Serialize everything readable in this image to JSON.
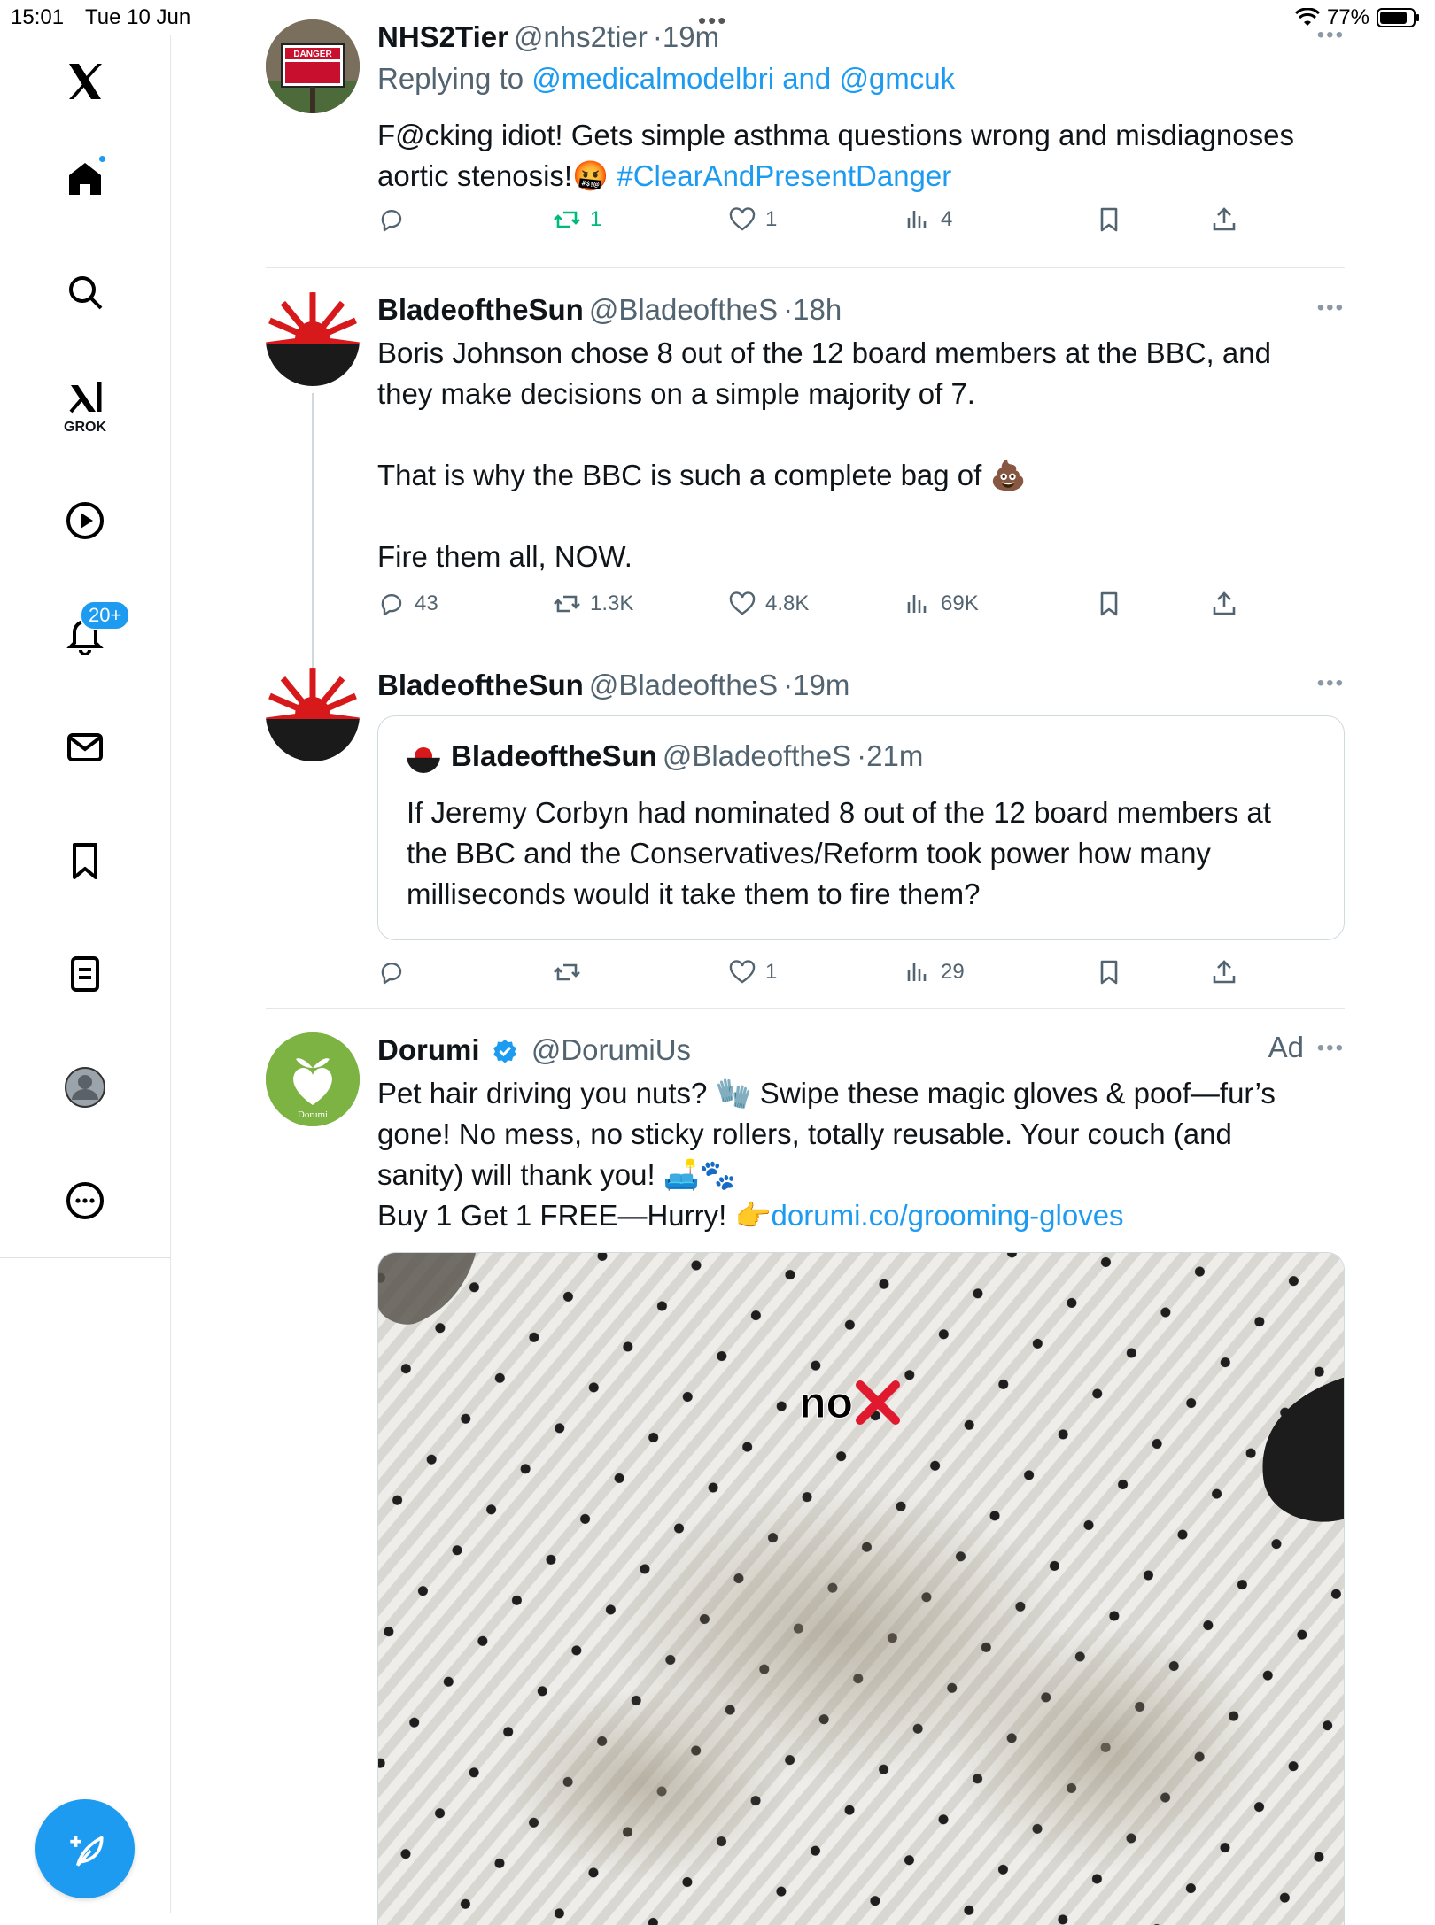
{
  "status": {
    "time": "15:01",
    "date": "Tue 10 Jun",
    "battery": "77%"
  },
  "sidebar": {
    "grok_label": "GROK",
    "notifications_badge": "20+",
    "items": [
      {
        "name": "x-logo"
      },
      {
        "name": "home"
      },
      {
        "name": "search"
      },
      {
        "name": "grok"
      },
      {
        "name": "video"
      },
      {
        "name": "notifications"
      },
      {
        "name": "messages"
      },
      {
        "name": "bookmarks"
      },
      {
        "name": "lists"
      },
      {
        "name": "profile"
      },
      {
        "name": "more"
      }
    ]
  },
  "tweets": [
    {
      "name": "NHS2Tier",
      "handle": "@nhs2tier",
      "time": "19m",
      "reply_prefix": "Replying to ",
      "reply_to_1": "@medicalmodelbri",
      "reply_and": " and ",
      "reply_to_2": "@gmcuk",
      "text": "F@cking idiot! Gets simple asthma questions wrong and misdiagnoses aortic stenosis!🤬",
      "hashtag": "#ClearAndPresentDanger",
      "replies": "",
      "retweets": "1",
      "likes": "1",
      "views": "4",
      "avatar_text_1": "DANGER",
      "avatar_text_2": "AUTHORIZED PERSONNEL ONLY BEYOND THIS POINT"
    },
    {
      "name": "BladeoftheSun",
      "handle": "@BladeoftheS",
      "time": "18h",
      "line1": "Boris Johnson chose 8 out of the 12 board members at the BBC, and",
      "line2": "they make decisions on a simple majority of 7.",
      "line3": "That is why the BBC is such a complete bag of 💩",
      "line4": "Fire them all, NOW.",
      "replies": "43",
      "retweets": "1.3K",
      "likes": "4.8K",
      "views": "69K"
    },
    {
      "name": "BladeoftheSun",
      "handle": "@BladeoftheS",
      "time": "19m",
      "quote": {
        "name": "BladeoftheSun",
        "handle": "@BladeoftheS",
        "time": "21m",
        "text": "If Jeremy Corbyn had nominated 8 out of the 12 board members at the BBC and the Conservatives/Reform took power how many milliseconds would it take them to fire them?"
      },
      "replies": "",
      "retweets": "",
      "likes": "1",
      "views": "29"
    },
    {
      "name": "Dorumi",
      "handle": "@DorumiUs",
      "ad_label": "Ad",
      "line1": "Pet hair driving you nuts? 🧤 Swipe these magic gloves & poof—fur’s",
      "line2": "gone! No mess, no sticky rollers, totally reusable. Your couch (and",
      "line3": "sanity) will thank you! 🛋️🐾",
      "line4_prefix": "Buy 1 Get 1 FREE—Hurry! 👉",
      "link": "dorumi.co/grooming-gloves",
      "avatar_text": "Dorumi",
      "media_label": "no"
    }
  ],
  "colors": {
    "accent": "#1d9bf0",
    "retweet_active": "#00ba7c",
    "text_secondary": "#536471"
  }
}
